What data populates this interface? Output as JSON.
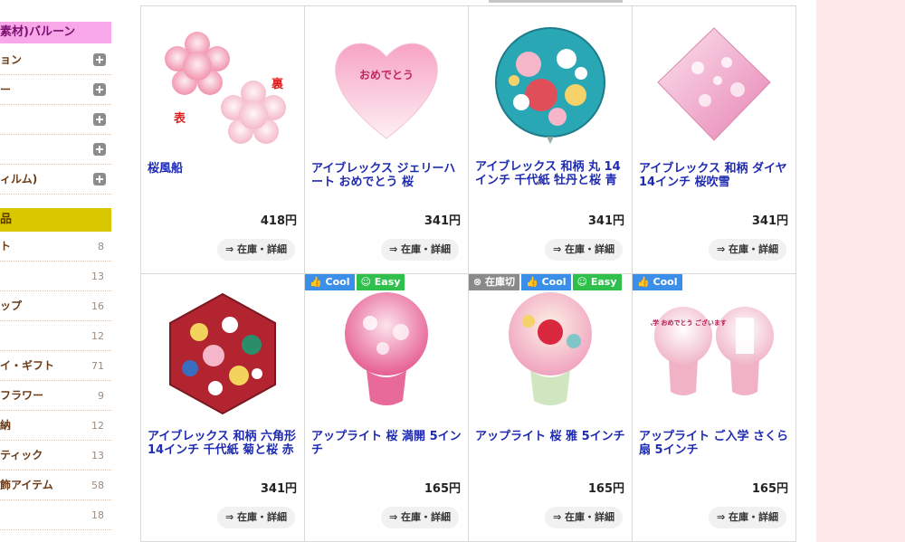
{
  "sidebar": {
    "head_pink": "素材)バルーン",
    "expand_items": [
      {
        "label": "ョン"
      },
      {
        "label": "ー"
      },
      {
        "label": ""
      },
      {
        "label": ""
      },
      {
        "label": "ィルム)"
      }
    ],
    "head_yellow": "品",
    "count_items": [
      {
        "label": "ト",
        "count": "8"
      },
      {
        "label": "",
        "count": "13"
      },
      {
        "label": "ップ",
        "count": "16"
      },
      {
        "label": "",
        "count": "12"
      },
      {
        "label": "イ・ギフト",
        "count": "71"
      },
      {
        "label": "フラワー",
        "count": "9"
      },
      {
        "label": "納",
        "count": "12"
      },
      {
        "label": "ティック",
        "count": "13"
      },
      {
        "label": "飾アイテム",
        "count": "58"
      },
      {
        "label": "",
        "count": "18"
      }
    ]
  },
  "products": [
    {
      "name": "桜風船",
      "price": "418円",
      "detail": "⇒ 在庫・詳細",
      "badges": [],
      "image": "sakura-balloon",
      "labels": [
        "表",
        "裏"
      ]
    },
    {
      "name": "アイブレックス ジェリーハート おめでとう 桜",
      "price": "341円",
      "detail": "⇒ 在庫・詳細",
      "badges": [],
      "image": "heart-balloon",
      "heart_text": "おめでとう"
    },
    {
      "name": "アイブレックス 和柄 丸 14インチ 千代紙 牡丹と桜 青",
      "price": "341円",
      "detail": "⇒ 在庫・詳細",
      "badges": [],
      "image": "round-balloon"
    },
    {
      "name": "アイブレックス 和柄 ダイヤ 14インチ 桜吹雪",
      "price": "341円",
      "detail": "⇒ 在庫・詳細",
      "badges": [],
      "image": "diamond-balloon"
    },
    {
      "name": "アイブレックス 和柄 六角形 14インチ 千代紙 菊と桜 赤",
      "price": "341円",
      "detail": "⇒ 在庫・詳細",
      "badges": [],
      "image": "hexagon-balloon"
    },
    {
      "name": "アップライト 桜 満開 5インチ",
      "price": "165円",
      "detail": "⇒ 在庫・詳細",
      "badges": [
        {
          "type": "cool",
          "text": "Cool"
        },
        {
          "type": "easy",
          "text": "Easy"
        }
      ],
      "image": "upright-balloon-pink"
    },
    {
      "name": "アップライト 桜 雅 5インチ",
      "price": "165円",
      "detail": "⇒ 在庫・詳細",
      "badges": [
        {
          "type": "oos",
          "text": "在庫切"
        },
        {
          "type": "cool",
          "text": "Cool"
        },
        {
          "type": "easy",
          "text": "Easy"
        }
      ],
      "image": "upright-balloon-green"
    },
    {
      "name": "アップライト ご入学 さくら扇 5インチ",
      "price": "165円",
      "detail": "⇒ 在庫・詳細",
      "badges": [
        {
          "type": "cool",
          "text": "Cool"
        }
      ],
      "image": "upright-balloon-pair",
      "balloon_text": "ご入学 おめでとう ございます"
    }
  ]
}
